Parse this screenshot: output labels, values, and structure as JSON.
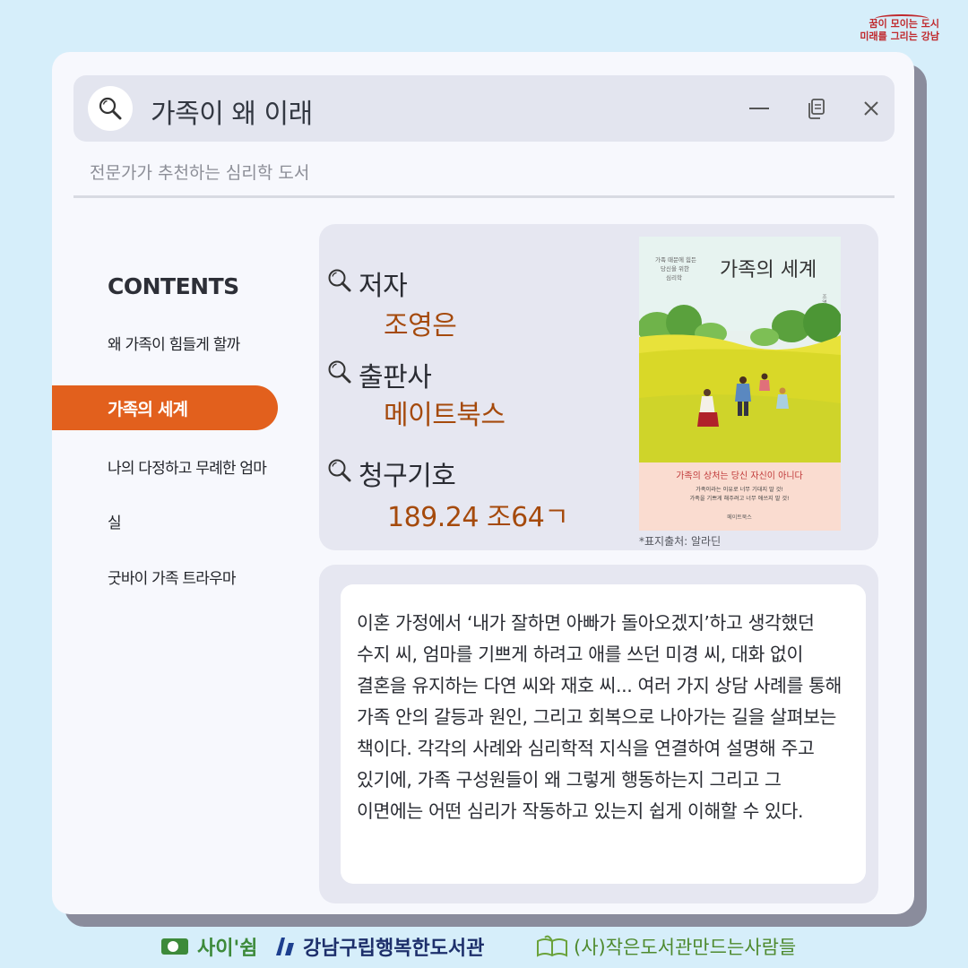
{
  "brand": {
    "line1": "꿈이 모이는 도시",
    "line2": "미래를 그리는 강남"
  },
  "window": {
    "title": "가족이 왜 이래",
    "subtitle": "전문가가 추천하는 심리학 도서",
    "icons": [
      "search-icon",
      "minimize-icon",
      "copy-icon",
      "close-icon"
    ]
  },
  "sidebar": {
    "heading": "CONTENTS",
    "items": [
      {
        "label": "왜  가족이 힘들게 할까",
        "active": false
      },
      {
        "label": "가족의 세계",
        "active": true
      },
      {
        "label": "나의 다정하고 무례한 엄마",
        "active": false
      },
      {
        "label": "실",
        "active": false
      },
      {
        "label": "굿바이 가족 트라우마",
        "active": false
      }
    ]
  },
  "book": {
    "author_label": "저자",
    "author": "조영은",
    "publisher_label": "출판사",
    "publisher": "메이트북스",
    "call_number_label": "청구기호",
    "call_number": "189.24 조64ㄱ",
    "cover": {
      "tagline": "가족 때문에 힘든\n당신을 위한\n심리학",
      "title": "가족의 세계",
      "author_vertical": "조영은 지음",
      "band_title": "가족의 상처는 당신 자신이 아니다",
      "band_line1": "가족이라는 이유로 너무 기대지 말 것!",
      "band_line2": "가족을 기쁘게 해주려고 너무 애쓰지 말 것!",
      "publisher_mark": "메이트북스"
    },
    "cover_caption": "*표지출처: 알라딘"
  },
  "description": "이혼 가정에서 ‘내가 잘하면 아빠가 돌아오겠지’하고 생각했던 수지 씨, 엄마를 기쁘게 하려고 애를 쓰던 미경 씨, 대화 없이 결혼을 유지하는 다연 씨와 재호 씨... 여러 가지 상담 사례를 통해 가족 안의 갈등과 원인, 그리고 회복으로 나아가는 길을 살펴보는 책이다. 각각의 사례와 심리학적 지식을 연결하여 설명해 주고 있기에, 가족 구성원들이 왜 그렇게 행동하는지 그리고 그 이면에는 어떤 심리가 작동하고 있는지 쉽게 이해할 수 있다.",
  "footer": {
    "logo1": "사이'쉼",
    "logo2": "강남구립행복한도서관",
    "logo3": "(사)작은도서관만드는사람들"
  },
  "colors": {
    "accent": "#e2601d",
    "value_text": "#a54a0c",
    "background": "#d6eefa",
    "window": "#f7f8fd",
    "card": "#e6e7f1"
  }
}
